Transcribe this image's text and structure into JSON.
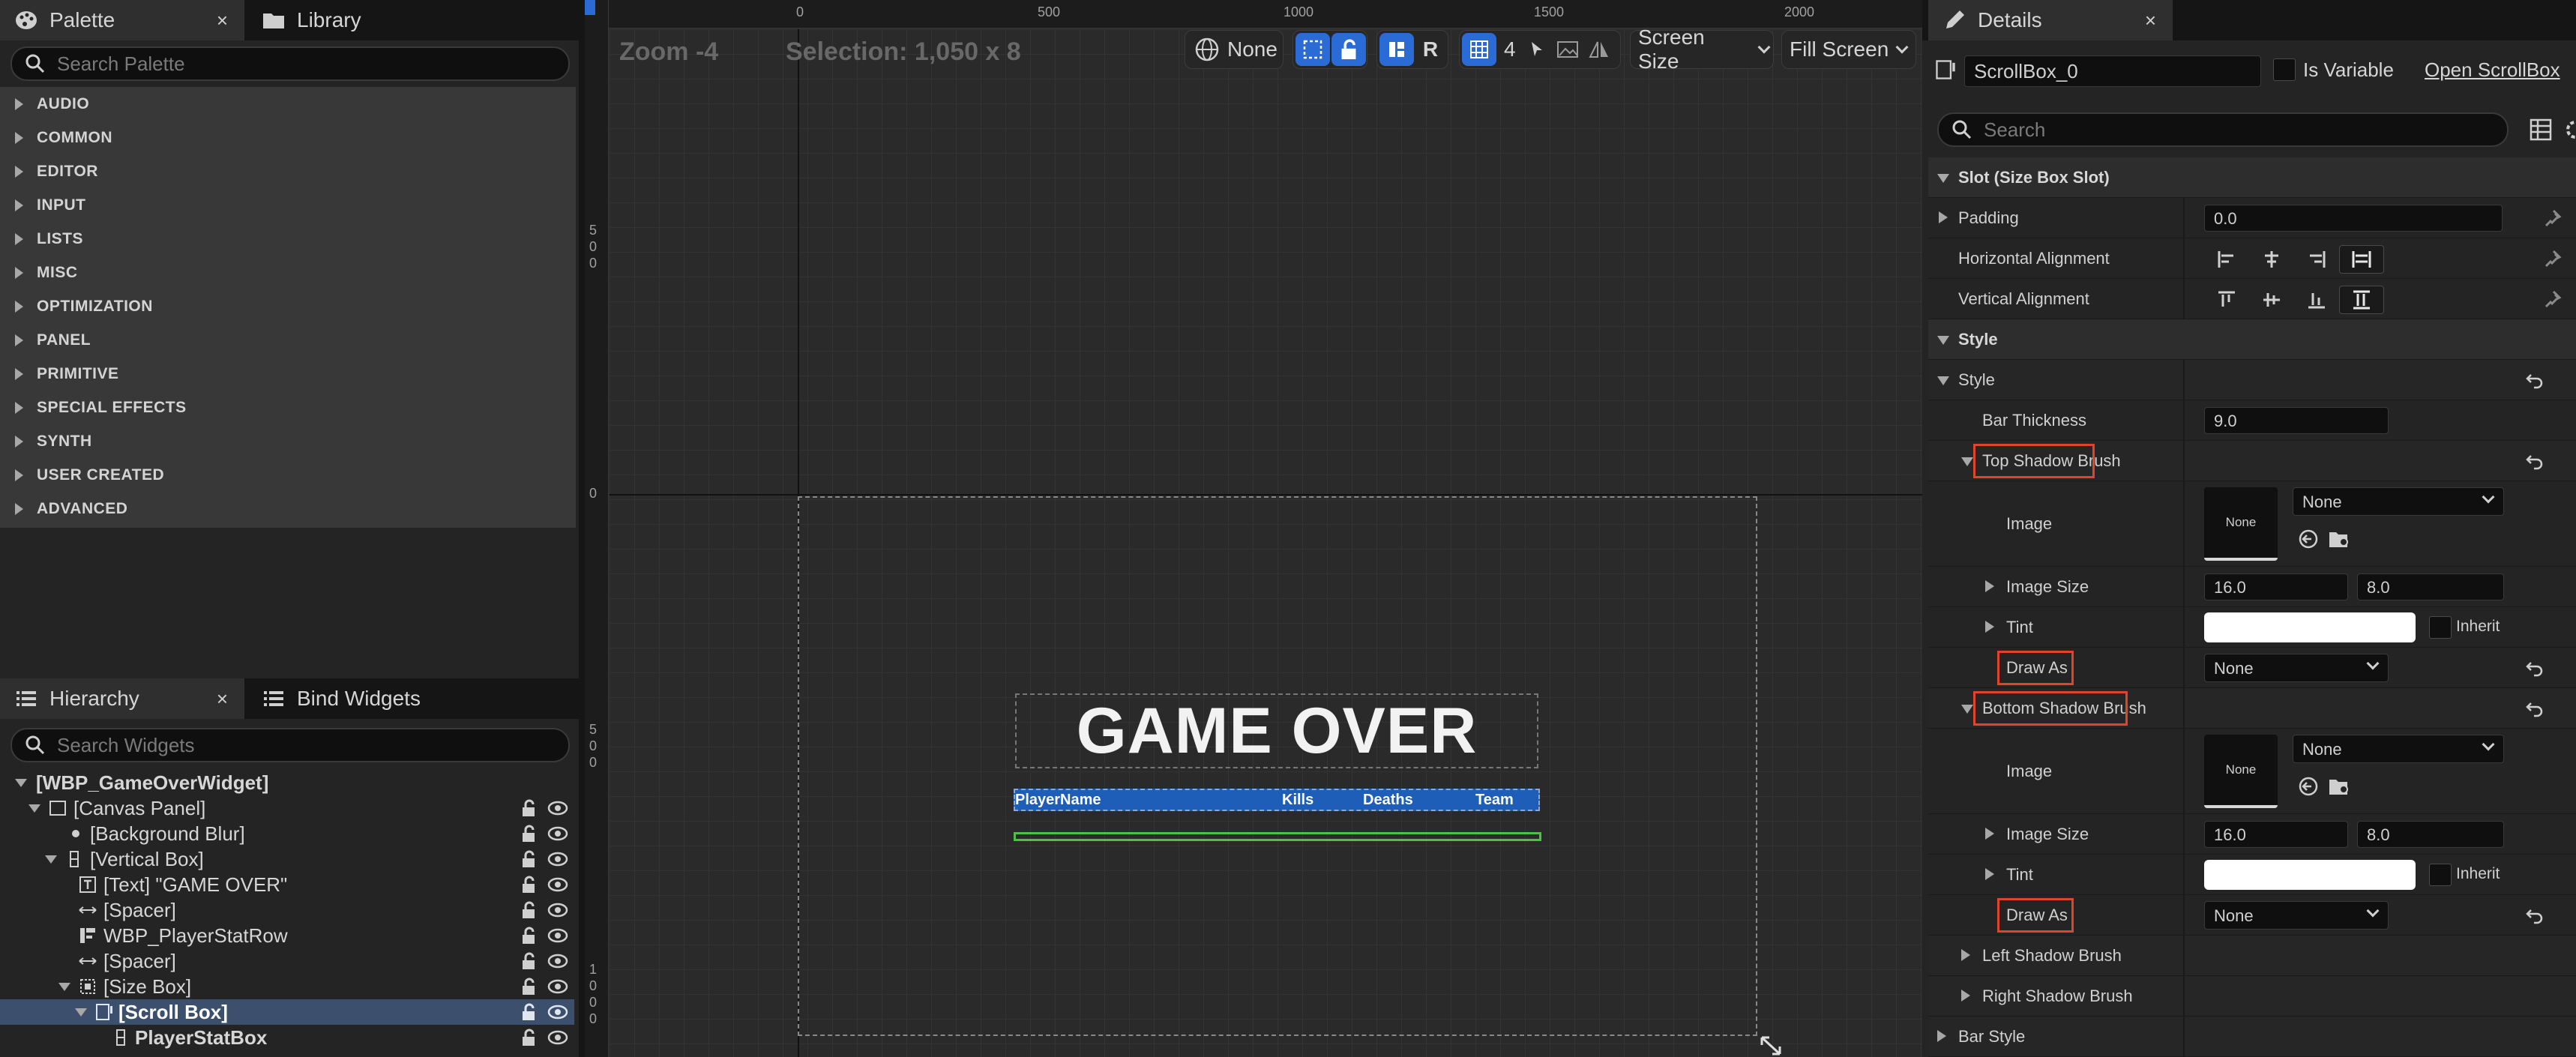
{
  "palette": {
    "tab_label": "Palette",
    "tab_close": "×",
    "library_tab_label": "Library",
    "search_placeholder": "Search Palette",
    "categories": [
      "AUDIO",
      "COMMON",
      "EDITOR",
      "INPUT",
      "LISTS",
      "MISC",
      "OPTIMIZATION",
      "PANEL",
      "PRIMITIVE",
      "SPECIAL EFFECTS",
      "SYNTH",
      "USER CREATED",
      "ADVANCED"
    ]
  },
  "hierarchy": {
    "tab_label": "Hierarchy",
    "tab_close": "×",
    "bind_tab_label": "Bind Widgets",
    "search_placeholder": "Search Widgets",
    "items": [
      {
        "label": "[WBP_GameOverWidget]"
      },
      {
        "label": "[Canvas Panel]"
      },
      {
        "label": "[Background Blur]"
      },
      {
        "label": "[Vertical Box]"
      },
      {
        "label": "[Text] \"GAME OVER\""
      },
      {
        "label": "[Spacer]"
      },
      {
        "label": "WBP_PlayerStatRow"
      },
      {
        "label": "[Spacer]"
      },
      {
        "label": "[Size Box]"
      },
      {
        "label": "[Scroll Box]"
      },
      {
        "label": "PlayerStatBox"
      }
    ]
  },
  "designer": {
    "zoom": "Zoom -4",
    "selection": "Selection: 1,050 x 8",
    "ruler_top_labels": [
      "0",
      "500",
      "1000",
      "1500",
      "2000"
    ],
    "ruler_left_labels": [
      {
        "label": "500",
        "dir": "v"
      },
      {
        "label": "0",
        "dir": "h"
      },
      {
        "label": "500",
        "dir": "v"
      },
      {
        "label": "1000",
        "dir": "v"
      }
    ],
    "toolbar": {
      "localization_label": "None",
      "r_label": "R",
      "grid_snap_value": "4",
      "screen_size_label": "Screen Size",
      "fill_screen_label": "Fill Screen"
    },
    "preview": {
      "title": "GAME OVER",
      "columns": [
        "PlayerName",
        "Kills",
        "Deaths",
        "Team"
      ],
      "header_color": "#1e5db8",
      "selection_color": "#4cc145"
    }
  },
  "details": {
    "tab_label": "Details",
    "tab_close": "×",
    "widget_name": "ScrollBox_0",
    "is_variable_label": "Is Variable",
    "open_link": "Open ScrollBox",
    "search_placeholder": "Search",
    "rows": {
      "slot_header": "Slot (Size Box Slot)",
      "padding_label": "Padding",
      "padding_value": "0.0",
      "h_align_label": "Horizontal Alignment",
      "v_align_label": "Vertical Alignment",
      "style_header": "Style",
      "style_label": "Style",
      "bar_thickness_label": "Bar Thickness",
      "bar_thickness_value": "9.0",
      "top_shadow_label": "Top Shadow Brush",
      "image_label": "Image",
      "thumb_text": "None",
      "image_combo": "None",
      "image_size_label": "Image Size",
      "image_size_x": "16.0",
      "image_size_y": "8.0",
      "tint_label": "Tint",
      "inherit_label": "Inherit",
      "draw_as_label": "Draw As",
      "draw_as_value": "None",
      "bottom_shadow_label": "Bottom Shadow Brush",
      "left_shadow_label": "Left Shadow Brush",
      "right_shadow_label": "Right Shadow Brush",
      "bar_style_label": "Bar Style"
    },
    "highlight_color": "#e0452b"
  },
  "colors": {
    "accent_blue": "#2a6bd6",
    "selected_row": "#3c4f6d"
  }
}
